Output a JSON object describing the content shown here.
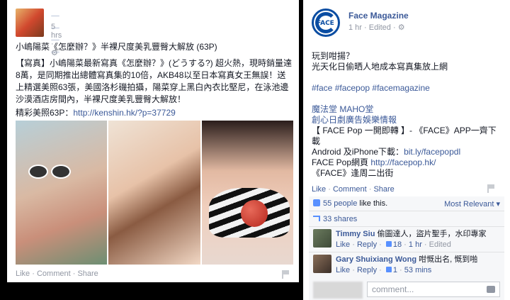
{
  "left_post": {
    "page_name": "一一一一",
    "time": "5 hrs · ",
    "title": "小嶋陽菜《怎麼辦？》半裸尺度美乳豐臀大解放 (63P)",
    "body": "【寫真】小嶋陽菜最新寫真《怎麼辦？》(どうする?) 超火熱，現時銷量達8萬，是同期推出總體寫真集的10倍，AKB48以至日本寫真女王無誤！送上精選美照63張，美國洛杉磯拍攝，陽菜穿上黑白內衣比堅尼，在泳池邊沙漠酒店房間內，半裸尺度美乳豐臀大解放！",
    "link_label": "精彩美照63P：",
    "link_url": "http://kenshin.hk/?p=37729",
    "actions": {
      "like": "Like",
      "comment": "Comment",
      "share": "Share",
      "sep": " · "
    }
  },
  "right_post": {
    "page_name": "Face Magazine",
    "logo_text": "FACE",
    "meta": "1 hr · Edited · ",
    "lines1": [
      "玩到咁揚？",
      "光天化日偷晒人地成本寫真集放上網"
    ],
    "hashtags": "#face #facepop #facemagazine",
    "lines2_blue": [
      "魔法堂 MAHO堂",
      "創心日劇廣告娛樂情報"
    ],
    "line3a": "【 FACE Pop 一開即轉 】- 《FACE》APP一齊下載",
    "line3b_label": "Android 及iPhone下載：",
    "line3b_link": "bit.ly/facepopdl",
    "line3c_label": "FACE Pop網頁 ",
    "line3c_link": "http://facepop.hk/",
    "line3d": "《FACE》逢周二出街",
    "actions": {
      "like": "Like",
      "comment": "Comment",
      "share": "Share",
      "sep": " · "
    },
    "likes_who": "55 people",
    "likes_rest": " like this.",
    "most_relevant": "Most Relevant ▾",
    "shares": "33 shares",
    "comments": [
      {
        "name": "Timmy Siu",
        "text": "偷圖達人，盜片聖手，水印專家",
        "like": "Like",
        "reply": "Reply",
        "count": "18",
        "time": "1 hr",
        "extra": "Edited"
      },
      {
        "name": "Gary Shuixiang Wong",
        "text": "咁慨出名, 慨到啪",
        "like": "Like",
        "reply": "Reply",
        "count": "1",
        "time": "53 mins",
        "extra": ""
      }
    ],
    "write_placeholder": "comment..."
  }
}
